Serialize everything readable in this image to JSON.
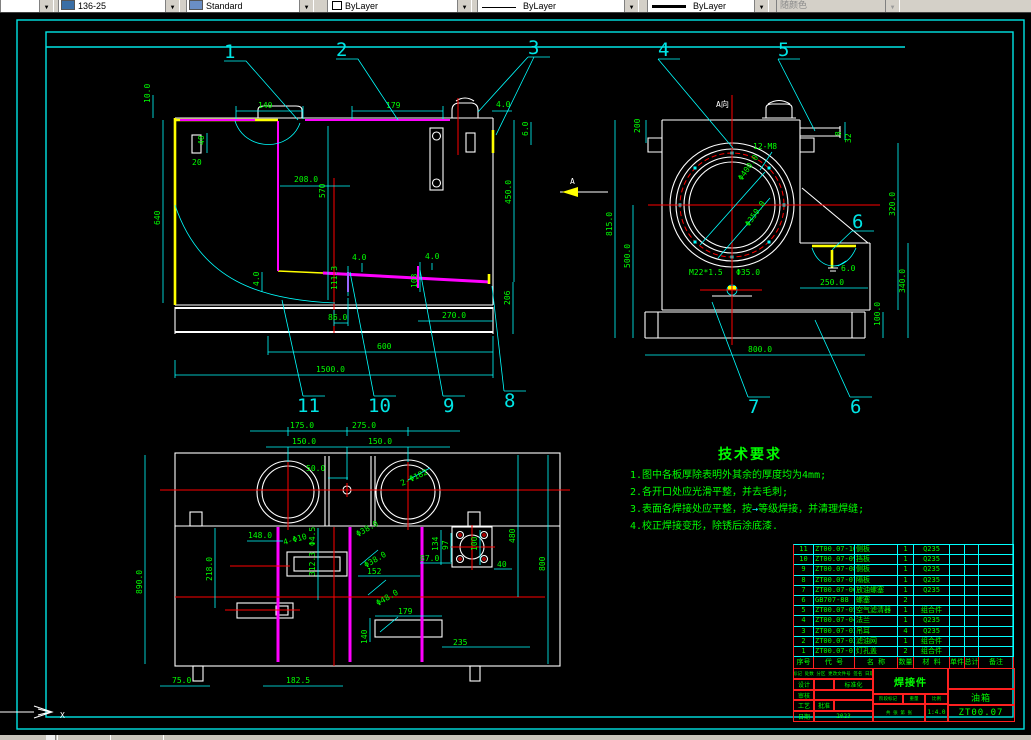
{
  "toolbar": {
    "dim_style": "136-25",
    "text_style": "Standard",
    "color_ctl": "ByLayer",
    "linetype_ctl": "ByLayer",
    "lineweight_ctl": "ByLayer",
    "plotstyle_ctl": "随颜色"
  },
  "labels": {
    "a_view": "A向",
    "a_arrow": "A",
    "x_axis": "X"
  },
  "balloons": {
    "b1": "1",
    "b2": "2",
    "b3": "3",
    "b4": "4",
    "b5": "5",
    "b6a": "6",
    "b6b": "6",
    "b7": "7",
    "b8": "8",
    "b9": "9",
    "b10": "10",
    "b11": "11"
  },
  "dims": {
    "front": [
      "10.0",
      "140",
      "179",
      "4.0",
      "6.0",
      "40",
      "20",
      "208.0",
      "570",
      "640",
      "450.0",
      "4.0",
      "4.0",
      "111.3",
      "103",
      "4.0",
      "86.0",
      "270.0",
      "206",
      "600",
      "1500.0"
    ],
    "side": [
      "200",
      "12-M8",
      "Φ400.0",
      "Φ350.0",
      "815.0",
      "500.0",
      "8",
      "32",
      "320.0",
      "340.0",
      "100.0",
      "M22*1.5",
      "Φ35.0",
      "6.0",
      "250.0",
      "800.0"
    ],
    "plan": [
      "175.0",
      "275.0",
      "150.0",
      "150.0",
      "50.0",
      "2-Φ182",
      "148.0",
      "4-Φ10",
      "Φ4.5",
      "134",
      "97",
      "87.0",
      "100",
      "40",
      "480",
      "800",
      "890.0",
      "218.0",
      "312.3",
      "Φ38.0",
      "Φ38.0",
      "Φ48.0",
      "152",
      "179",
      "140",
      "235",
      "75.0",
      "182.5"
    ]
  },
  "tech": {
    "title": "技术要求",
    "i1": "1.图中各板厚除表明外其余的厚度均为4mm;",
    "i2": "2.各开口处应光滑平整，并去毛刺;",
    "i3a": "3.表面各焊接处应平整，按",
    "weld_symbol": "→",
    "i3b": "等级焊接，并清理焊缝;",
    "i4": "4.校正焊接变形，除锈后涂底漆."
  },
  "table": {
    "headers": [
      "序号",
      "代 号",
      "名 称",
      "数量",
      "材 料",
      "单件",
      "总计",
      "备注"
    ],
    "rows": [
      [
        "11",
        "ZT00.07-10",
        "侧板",
        "1",
        "Q235",
        "",
        "",
        ""
      ],
      [
        "10",
        "ZT00.07-09",
        "挡板",
        "1",
        "Q235",
        "",
        "",
        ""
      ],
      [
        "9",
        "ZT00.07-08",
        "侧板",
        "1",
        "Q235",
        "",
        "",
        ""
      ],
      [
        "8",
        "ZT00.07-07",
        "隔板",
        "1",
        "Q235",
        "",
        "",
        ""
      ],
      [
        "7",
        "ZT00.07-06",
        "放油螺塞",
        "1",
        "Q235",
        "",
        "",
        ""
      ],
      [
        "6",
        "GB707-88",
        "螺塞",
        "2",
        "",
        "",
        "",
        ""
      ],
      [
        "5",
        "ZT00.07-05",
        "空气滤清器",
        "1",
        "组合件",
        "",
        "",
        ""
      ],
      [
        "4",
        "ZT00.07-04",
        "法兰",
        "1",
        "Q235",
        "",
        "",
        ""
      ],
      [
        "3",
        "ZT00.07-03",
        "吊耳",
        "4",
        "Q235",
        "",
        "",
        ""
      ],
      [
        "2",
        "ZT00.07-02",
        "滤油网",
        "1",
        "组合件",
        "",
        "",
        ""
      ],
      [
        "1",
        "ZT00.07-01",
        "灯孔盖",
        "2",
        "组合件",
        "",
        "",
        ""
      ]
    ]
  },
  "tb": {
    "part_type": "焊接件",
    "product": "油箱",
    "number": "ZT00.07",
    "rev_row": "标记 处数 分区 更改文件号 签名 日期",
    "design": "设计",
    "standardize": "标准化",
    "check": "审核",
    "craft": "工艺",
    "approve": "批准",
    "date_label": "日期",
    "date_value": "2023",
    "stage": "阶段标记",
    "weight": "重量",
    "ratio": "比例",
    "scale": "1:4.0",
    "sheet": "共 张 第 张"
  }
}
